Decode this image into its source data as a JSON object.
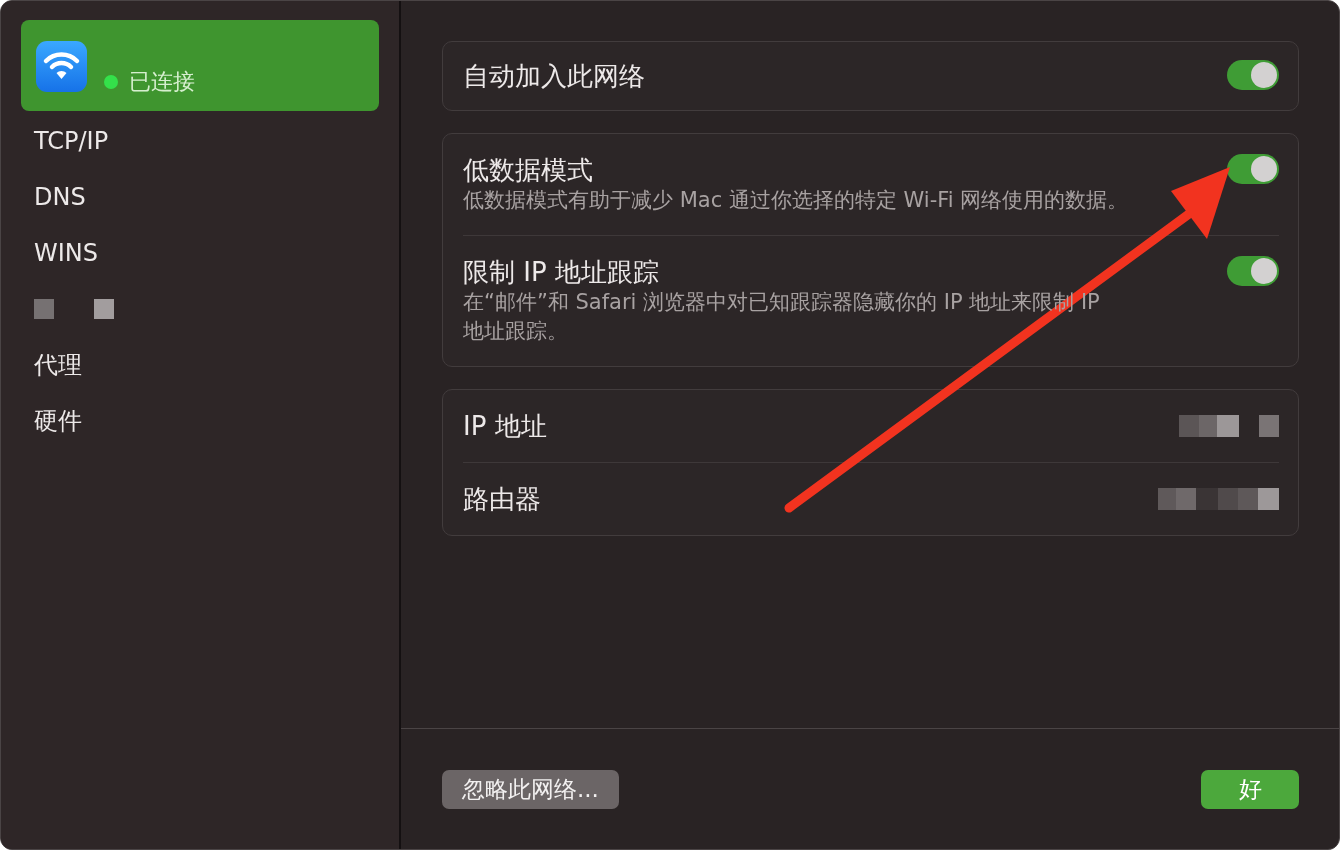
{
  "sidebar": {
    "items": [
      {
        "kind": "network",
        "status": "已连接",
        "connected": true,
        "selected": true
      },
      {
        "kind": "text",
        "label": "TCP/IP",
        "selected": false
      },
      {
        "kind": "text",
        "label": "DNS",
        "selected": false
      },
      {
        "kind": "text",
        "label": "WINS",
        "selected": false
      },
      {
        "kind": "redacted",
        "selected": false
      },
      {
        "kind": "text",
        "label": "代理",
        "selected": false
      },
      {
        "kind": "text",
        "label": "硬件",
        "selected": false
      }
    ]
  },
  "settings_groups": [
    {
      "rows": [
        {
          "kind": "toggle",
          "title": "自动加入此网络",
          "on": true
        }
      ]
    },
    {
      "rows": [
        {
          "kind": "toggle",
          "title": "低数据模式",
          "description": "低数据模式有助于减少 Mac 通过你选择的特定 Wi-Fi 网络使用的数据。",
          "on": true
        },
        {
          "kind": "toggle",
          "title": "限制 IP 地址跟踪",
          "description": "在“邮件”和 Safari 浏览器中对已知跟踪器隐藏你的 IP 地址来限制 IP 地址跟踪。",
          "on": true
        }
      ]
    },
    {
      "rows": [
        {
          "kind": "info",
          "label": "IP 地址",
          "value_redacted": true
        },
        {
          "kind": "info",
          "label": "路由器",
          "value_redacted": true
        }
      ]
    }
  ],
  "footer": {
    "buttons": [
      {
        "kind": "secondary",
        "label": "忽略此网络..."
      },
      {
        "kind": "primary",
        "label": "好"
      }
    ]
  }
}
